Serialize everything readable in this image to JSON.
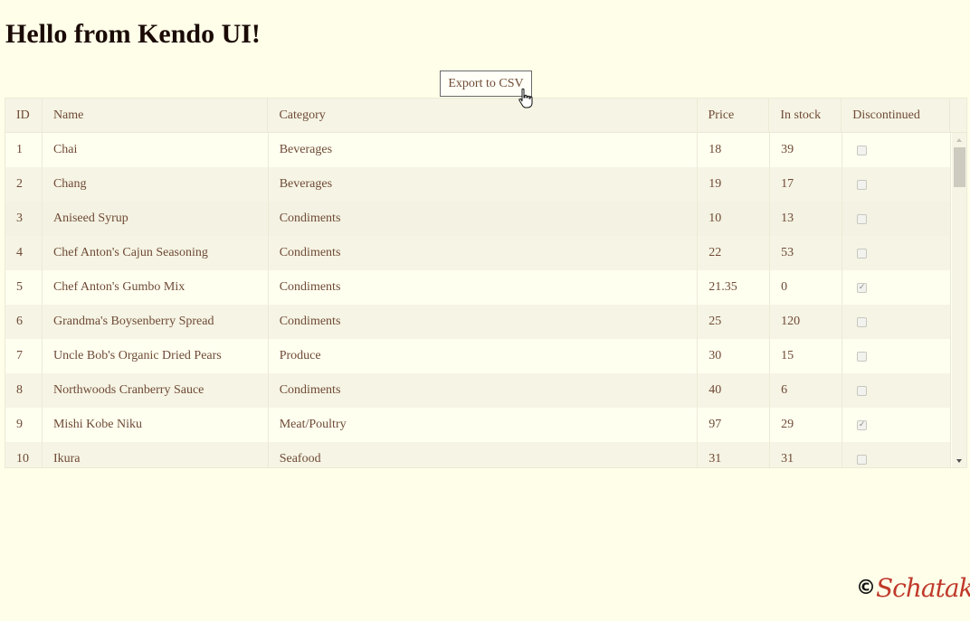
{
  "page": {
    "heading": "Hello from Kendo UI!"
  },
  "toolbar": {
    "export_label": "Export to CSV"
  },
  "grid": {
    "columns": [
      "ID",
      "Name",
      "Category",
      "Price",
      "In stock",
      "Discontinued"
    ],
    "rows": [
      {
        "id": "1",
        "name": "Chai",
        "category": "Beverages",
        "price": "18",
        "stock": "39",
        "discontinued": false
      },
      {
        "id": "2",
        "name": "Chang",
        "category": "Beverages",
        "price": "19",
        "stock": "17",
        "discontinued": false
      },
      {
        "id": "3",
        "name": "Aniseed Syrup",
        "category": "Condiments",
        "price": "10",
        "stock": "13",
        "discontinued": false
      },
      {
        "id": "4",
        "name": "Chef Anton's Cajun Seasoning",
        "category": "Condiments",
        "price": "22",
        "stock": "53",
        "discontinued": false
      },
      {
        "id": "5",
        "name": "Chef Anton's Gumbo Mix",
        "category": "Condiments",
        "price": "21.35",
        "stock": "0",
        "discontinued": true
      },
      {
        "id": "6",
        "name": "Grandma's Boysenberry Spread",
        "category": "Condiments",
        "price": "25",
        "stock": "120",
        "discontinued": false
      },
      {
        "id": "7",
        "name": "Uncle Bob's Organic Dried Pears",
        "category": "Produce",
        "price": "30",
        "stock": "15",
        "discontinued": false
      },
      {
        "id": "8",
        "name": "Northwoods Cranberry Sauce",
        "category": "Condiments",
        "price": "40",
        "stock": "6",
        "discontinued": false
      },
      {
        "id": "9",
        "name": "Mishi Kobe Niku",
        "category": "Meat/Poultry",
        "price": "97",
        "stock": "29",
        "discontinued": true
      },
      {
        "id": "10",
        "name": "Ikura",
        "category": "Seafood",
        "price": "31",
        "stock": "31",
        "discontinued": false
      }
    ]
  },
  "footer": {
    "copyright_symbol": "©",
    "brand": "Schatak"
  }
}
